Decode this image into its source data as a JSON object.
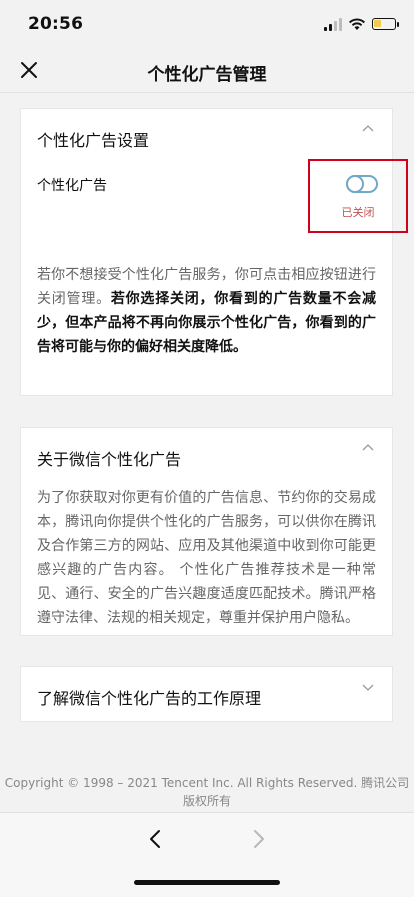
{
  "status_bar": {
    "time": "20:56",
    "battery_level": 0.35,
    "battery_color": "#f2c94c"
  },
  "navbar": {
    "title": "个性化广告管理",
    "close_icon": "close-icon"
  },
  "settings_card": {
    "heading": "个性化广告设置",
    "toggle_label": "个性化广告",
    "toggle_state": "已关闭",
    "toggle_on": false,
    "highlight_color": "#d0021b",
    "description_plain": "若你不想接受个性化广告服务，你可点击相应按钮进行关闭管理。",
    "description_bold": "若你选择关闭，你看到的广告数量不会减少，但本产品将不再向你展示个性化广告，你看到的广告将可能与你的偏好相关度降低。"
  },
  "about_card": {
    "heading": "关于微信个性化广告",
    "body": "为了你获取对你更有价值的广告信息、节约你的交易成本，腾讯向你提供个性化的广告服务，可以供你在腾讯及合作第三方的网站、应用及其他渠道中收到你可能更感兴趣的广告内容。 个性化广告推荐技术是一种常见、通行、安全的广告兴趣度适度匹配技术。腾讯严格遵守法律、法规的相关规定，尊重并保护用户隐私。"
  },
  "how_card": {
    "heading": "了解微信个性化广告的工作原理"
  },
  "footer": {
    "copyright": "Copyright © 1998 – 2021 Tencent Inc. All Rights Reserved. 腾讯公司 版权所有"
  }
}
